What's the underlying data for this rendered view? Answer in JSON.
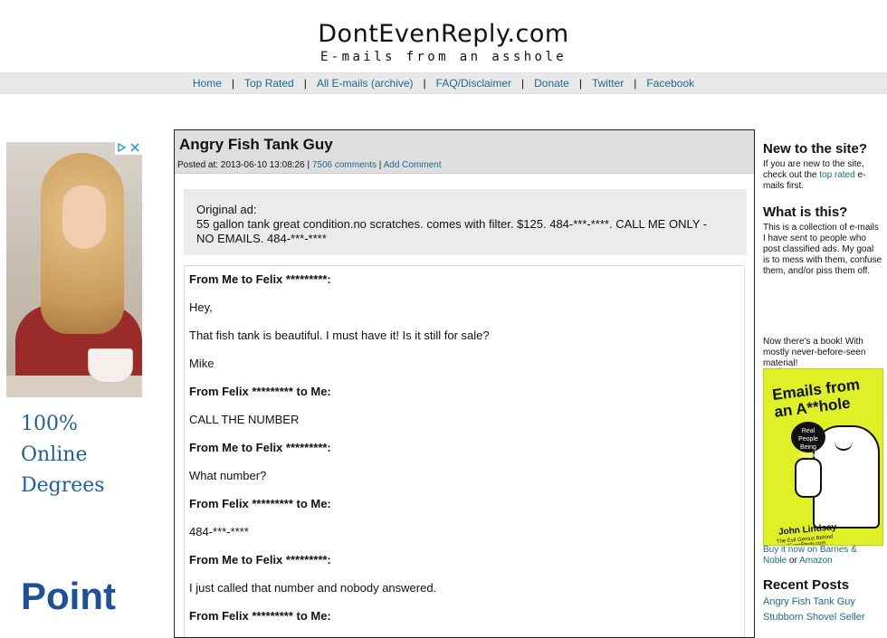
{
  "site": {
    "title": "DontEvenReply.com",
    "tagline": "E-mails from an asshole"
  },
  "nav": {
    "items": [
      "Home",
      "Top Rated",
      "All E-mails (archive)",
      "FAQ/Disclaimer",
      "Donate",
      "Twitter",
      "Facebook"
    ],
    "separator": "|"
  },
  "ad": {
    "choices_icon": "adchoices-icon",
    "headline_lines": [
      "100%",
      "Online",
      "Degrees"
    ],
    "brand": "Point"
  },
  "post": {
    "title": "Angry Fish Tank Guy",
    "posted_label": "Posted at: 2013-06-10 13:08:26 |",
    "comments_link": "7506 comments",
    "meta_sep": "|",
    "add_comment_link": "Add Comment",
    "original_label": "Original ad:",
    "original_body": "55 gallon tank great condition.no scratches. comes with filter. $125. 484-***-****. CALL ME ONLY - NO EMAILS. 484-***-****",
    "lines": [
      {
        "text": "From Me to Felix *********:",
        "bold": true
      },
      {
        "text": "Hey,",
        "bold": false
      },
      {
        "text": "That fish tank is beautiful. I must have it! Is it still for sale?",
        "bold": false
      },
      {
        "text": "Mike",
        "bold": false
      },
      {
        "text": "From Felix ********* to Me:",
        "bold": true
      },
      {
        "text": "CALL THE NUMBER",
        "bold": false
      },
      {
        "text": "From Me to Felix *********:",
        "bold": true
      },
      {
        "text": "What number?",
        "bold": false
      },
      {
        "text": "From Felix ********* to Me:",
        "bold": true
      },
      {
        "text": "484-***-****",
        "bold": false
      },
      {
        "text": "From Me to Felix *********:",
        "bold": true
      },
      {
        "text": "I just called that number and nobody answered.",
        "bold": false
      },
      {
        "text": "From Felix ********* to Me:",
        "bold": true
      }
    ]
  },
  "sidebar": {
    "new_heading": "New to the site?",
    "new_text_before": "If you are new to the site, check out the ",
    "new_link": "top rated",
    "new_text_after": " e-mails first.",
    "what_heading": "What is this?",
    "what_text": "This is a collection of e-mails I have sent to people who post classified ads. My goal is to mess with them, confuse them, and/or piss them off.",
    "book_note": "Now there's a book! With mostly never-before-seen material!",
    "book": {
      "title": "Emails from an A**hole",
      "bubble": "Real People Being Stupid",
      "author": "John Lindsay",
      "subtitle": "The Evil Genius Behind DontEvenReply.com"
    },
    "buy_link": "Buy it now on Barnes & Noble",
    "buy_or": "or",
    "amazon_link": "Amazon",
    "recent_heading": "Recent Posts",
    "recent": [
      "Angry Fish Tank Guy",
      "Stubborn Shovel Seller"
    ]
  }
}
